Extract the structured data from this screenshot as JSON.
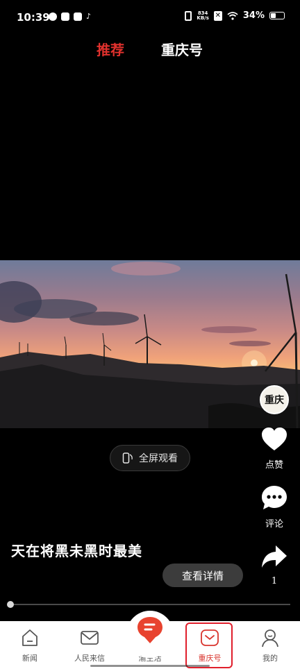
{
  "status_bar": {
    "time": "10:39",
    "net_speed_value": "834",
    "net_speed_unit": "KB/s",
    "battery": "34%"
  },
  "top_tabs": [
    {
      "label": "推荐",
      "active": true
    },
    {
      "label": "重庆号",
      "active": false
    }
  ],
  "video": {
    "fullscreen_label": "全屏观看",
    "title": "天在将黑未黑时最美",
    "detail_button": "查看详情",
    "progress_fraction": 0.0
  },
  "actions": {
    "avatar_text": "重庆",
    "like_label": "点赞",
    "comment_label": "评论",
    "share_count": "1"
  },
  "bottom_nav": [
    {
      "label": "新闻",
      "icon": "house-icon"
    },
    {
      "label": "人民来信",
      "icon": "envelope-icon"
    },
    {
      "label": "渝生活",
      "icon": "location-pin-icon"
    },
    {
      "label": "重庆号",
      "icon": "chongqing-icon",
      "active": true
    },
    {
      "label": "我的",
      "icon": "person-icon"
    }
  ],
  "colors": {
    "accent": "#e0312d",
    "background": "#000000",
    "nav_background": "#ffffff",
    "highlight_box": "#e01e2b"
  }
}
